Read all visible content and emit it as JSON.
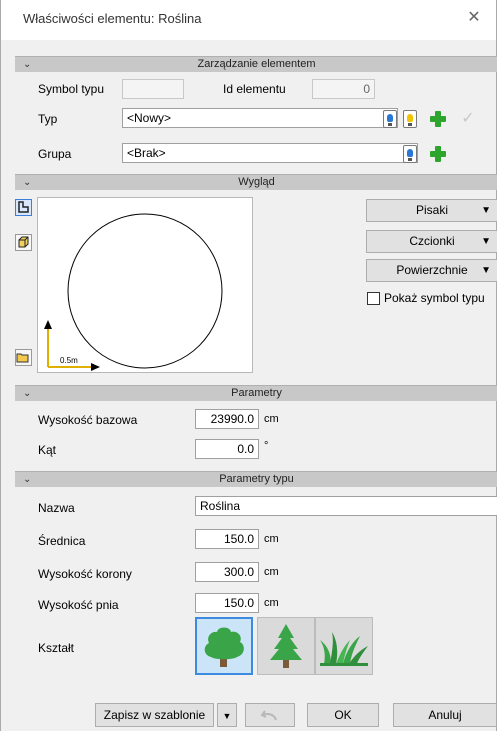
{
  "window": {
    "title": "Właściwości elementu: Roślina",
    "close_glyph": "✕"
  },
  "sections": {
    "management": "Zarządzanie elementem",
    "appearance": "Wygląd",
    "parameters": "Parametry",
    "type_parameters": "Parametry typu"
  },
  "management": {
    "type_symbol_label": "Symbol typu",
    "type_symbol_value": "",
    "element_id_label": "Id elementu",
    "element_id_value": "0",
    "type_label": "Typ",
    "type_value": "<Nowy>",
    "group_label": "Grupa",
    "group_value": "<Brak>"
  },
  "appearance": {
    "scale_label": "0.5m",
    "pens_button": "Pisaki",
    "fonts_button": "Czcionki",
    "surfaces_button": "Powierzchnie",
    "show_type_symbol_label": "Pokaż symbol typu",
    "show_type_symbol_checked": false
  },
  "parameters": {
    "base_height_label": "Wysokość bazowa",
    "base_height_value": "23990.0",
    "base_height_unit": "cm",
    "angle_label": "Kąt",
    "angle_value": "0.0",
    "angle_unit": "°"
  },
  "type_parameters": {
    "name_label": "Nazwa",
    "name_value": "Roślina",
    "diameter_label": "Średnica",
    "diameter_value": "150.0",
    "diameter_unit": "cm",
    "crown_height_label": "Wysokość korony",
    "crown_height_value": "300.0",
    "crown_height_unit": "cm",
    "trunk_height_label": "Wysokość pnia",
    "trunk_height_value": "150.0",
    "trunk_height_unit": "cm",
    "shape_label": "Kształt",
    "shapes": [
      "deciduous-tree-icon",
      "conifer-tree-icon",
      "grass-icon"
    ],
    "selected_shape": "deciduous-tree-icon"
  },
  "footer": {
    "save_template": "Zapisz w szablonie",
    "ok": "OK",
    "cancel": "Anuluj"
  },
  "colors": {
    "accent_green": "#2da52d",
    "selection_blue": "#3c8be0",
    "section_bg": "#c8c8c8"
  }
}
